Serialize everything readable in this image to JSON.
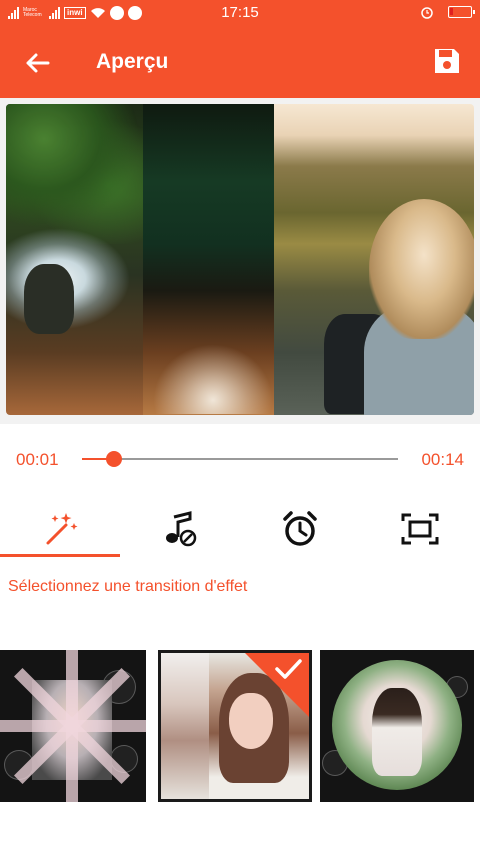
{
  "status_bar": {
    "carrier_text": "Maroc Telecom",
    "operator2": "inwi",
    "time": "17:15",
    "battery_level": 0.15,
    "battery_color": "#e02020"
  },
  "app_bar": {
    "title": "Aperçu",
    "back_icon": "arrow-left-icon",
    "save_icon": "floppy-disk-icon",
    "color": "#f4512c"
  },
  "player": {
    "current_time": "00:01",
    "total_time": "00:14",
    "progress": 0.1
  },
  "tabs": [
    {
      "name": "transitions",
      "icon": "magic-wand-icon",
      "selected": true
    },
    {
      "name": "music",
      "icon": "music-off-icon",
      "selected": false
    },
    {
      "name": "duration",
      "icon": "alarm-clock-icon",
      "selected": false
    },
    {
      "name": "ratio",
      "icon": "crop-frame-icon",
      "selected": false
    }
  ],
  "section_label": "Sélectionnez une transition d'effet",
  "effects": [
    {
      "name": "starburst",
      "selected": false
    },
    {
      "name": "split",
      "selected": true
    },
    {
      "name": "circle",
      "selected": false
    }
  ]
}
